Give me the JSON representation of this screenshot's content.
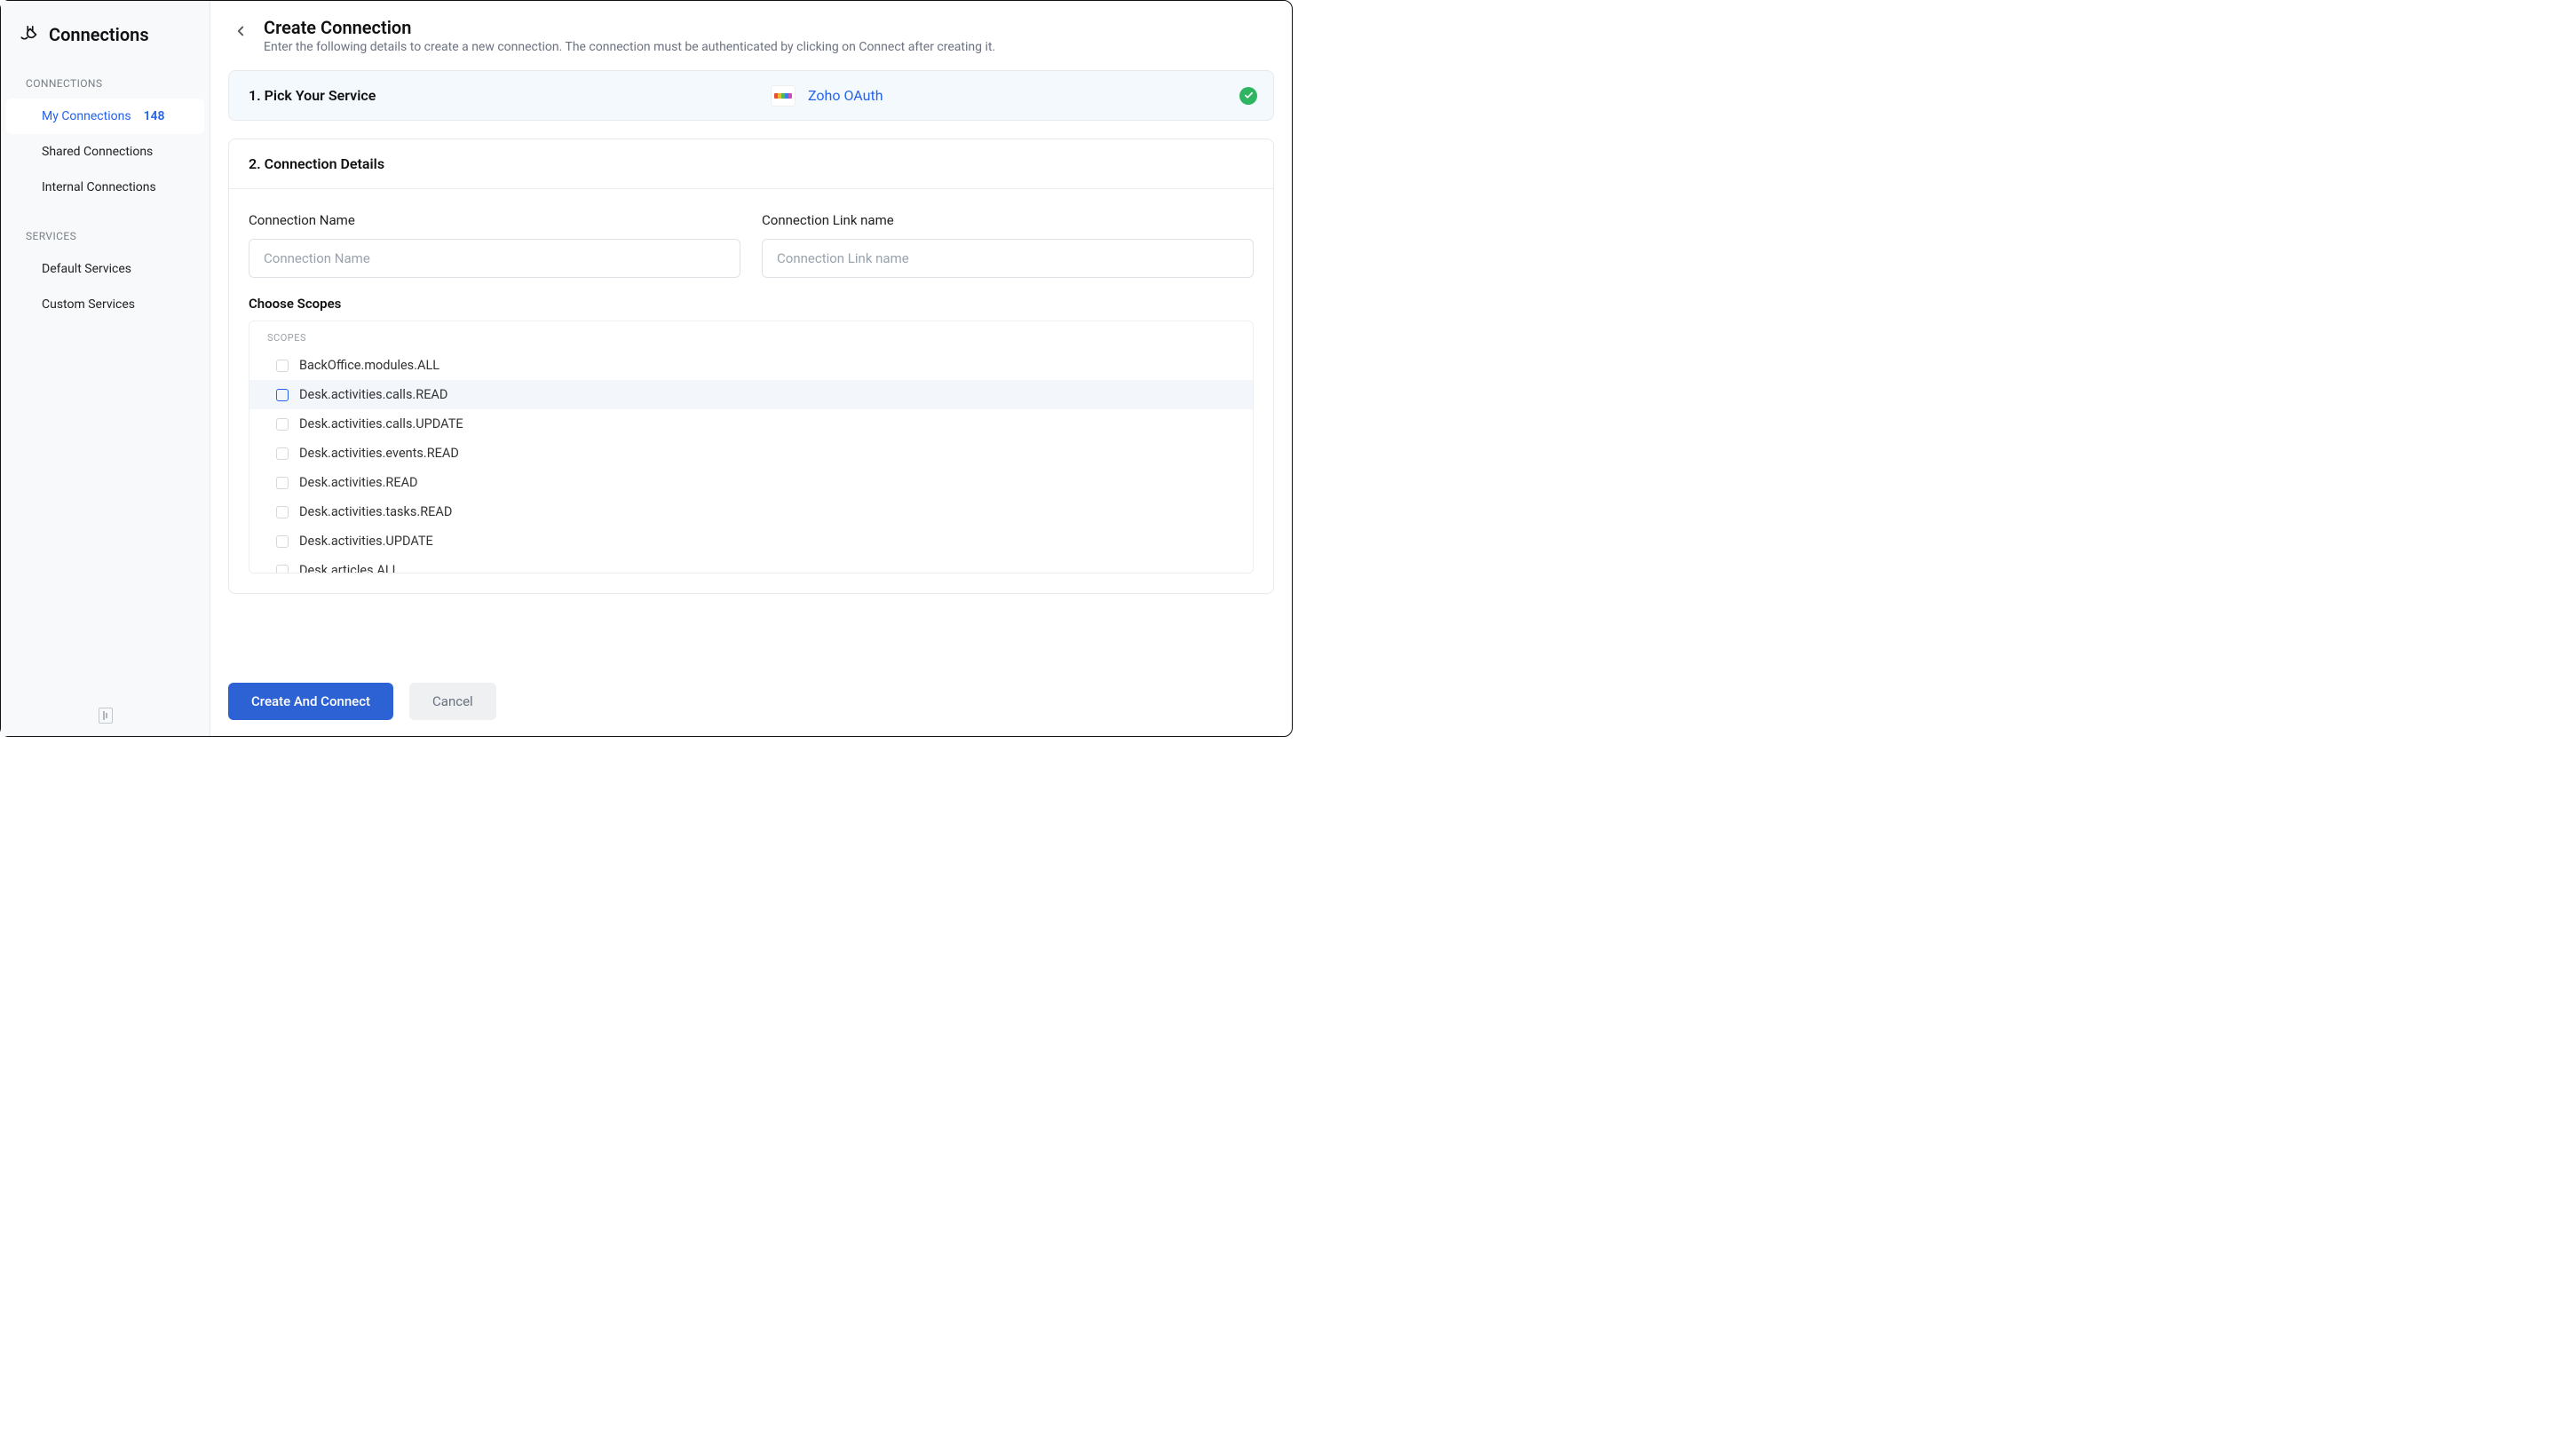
{
  "sidebar": {
    "title": "Connections",
    "sections": {
      "connections_label": "CONNECTIONS",
      "services_label": "SERVICES"
    },
    "items": {
      "my_connections": {
        "label": "My Connections",
        "count": "148"
      },
      "shared": {
        "label": "Shared Connections"
      },
      "internal": {
        "label": "Internal Connections"
      },
      "default_services": {
        "label": "Default Services"
      },
      "custom_services": {
        "label": "Custom Services"
      }
    }
  },
  "header": {
    "title": "Create Connection",
    "subtitle": "Enter the following details to create a new connection. The connection must be authenticated by clicking on Connect after creating it."
  },
  "step1": {
    "title": "1. Pick Your Service",
    "service_name": "Zoho OAuth"
  },
  "step2": {
    "title": "2. Connection Details",
    "name_label": "Connection Name",
    "name_placeholder": "Connection Name",
    "link_label": "Connection Link name",
    "link_placeholder": "Connection Link name",
    "scopes_label": "Choose Scopes",
    "scopes_heading": "SCOPES",
    "scopes": [
      "BackOffice.modules.ALL",
      "Desk.activities.calls.READ",
      "Desk.activities.calls.UPDATE",
      "Desk.activities.events.READ",
      "Desk.activities.READ",
      "Desk.activities.tasks.READ",
      "Desk.activities.UPDATE",
      "Desk.articles.ALL"
    ]
  },
  "buttons": {
    "primary": "Create And Connect",
    "cancel": "Cancel"
  }
}
